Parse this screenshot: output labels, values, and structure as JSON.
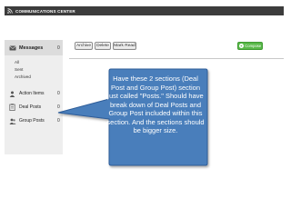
{
  "app": {
    "title": "COMMUNICATIONS CENTER",
    "icon": "rss-feed-icon"
  },
  "sidebar": {
    "messages": {
      "label": "Messages",
      "count": "0",
      "icon": "envelope-icon"
    },
    "folders": [
      "All",
      "Sent",
      "Archived"
    ],
    "items": [
      {
        "label": "Action Items",
        "count": "0",
        "icon": "person-icon"
      },
      {
        "label": "Deal Posts",
        "count": "0",
        "icon": "clipboard-icon"
      },
      {
        "label": "Group Posts",
        "count": "0",
        "icon": "group-icon"
      }
    ]
  },
  "toolbar": {
    "archive_label": "Archive",
    "delete_label": "Delete",
    "mark_read_label": "Mark Read",
    "compose_label": "Compose"
  },
  "callout": {
    "text": "Have these 2 sections (Deal Post and Group Post) section just called \"Posts.\" Should have break down of Deal Posts and Group Post included within this section.  And the sections should be bigger size.",
    "fill_color": "#4a7ebb",
    "border_color": "#2e5d99"
  },
  "colors": {
    "topbar": "#3c3c3c",
    "sidebar": "#eeeeee",
    "compose": "#58b848"
  }
}
